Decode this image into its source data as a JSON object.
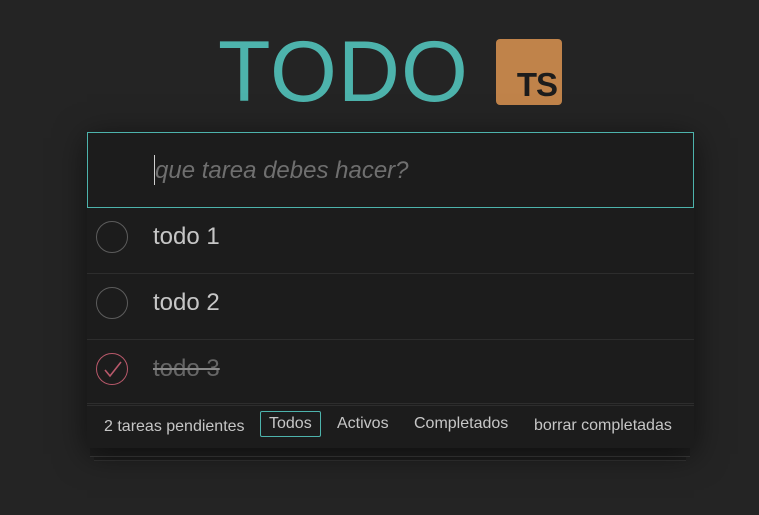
{
  "header": {
    "title": "TODO",
    "logo_text": "TS"
  },
  "new_todo": {
    "placeholder": "que tarea debes hacer?",
    "value": ""
  },
  "todos": [
    {
      "label": "todo 1",
      "completed": false
    },
    {
      "label": "todo 2",
      "completed": false
    },
    {
      "label": "todo 3",
      "completed": true
    }
  ],
  "footer": {
    "count_text": "2 tareas pendientes",
    "filters": [
      {
        "label": "Todos",
        "selected": true
      },
      {
        "label": "Activos",
        "selected": false
      },
      {
        "label": "Completados",
        "selected": false
      }
    ],
    "clear_label": "borrar completadas"
  },
  "colors": {
    "accent": "#4db3ac",
    "logo_bg": "#c0834a",
    "check": "#b8586a",
    "background": "#242424"
  }
}
